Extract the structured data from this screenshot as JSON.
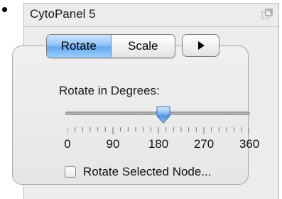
{
  "panel": {
    "title": "CytoPanel 5",
    "float_icon": "float-window-icon"
  },
  "mode_tabs": [
    {
      "label": "Rotate",
      "selected": true
    },
    {
      "label": "Scale",
      "selected": false
    }
  ],
  "play_button": {
    "icon": "play-triangle-icon"
  },
  "rotate": {
    "label": "Rotate in Degrees:",
    "min": 0,
    "max": 360,
    "value": 190,
    "tick_labels": [
      "0",
      "90",
      "180",
      "270",
      "360"
    ]
  },
  "selected_only": {
    "label": "Rotate Selected Node...",
    "checked": false
  },
  "colors": {
    "accent": "#66a8ee",
    "panel_bg": "#ececec"
  }
}
